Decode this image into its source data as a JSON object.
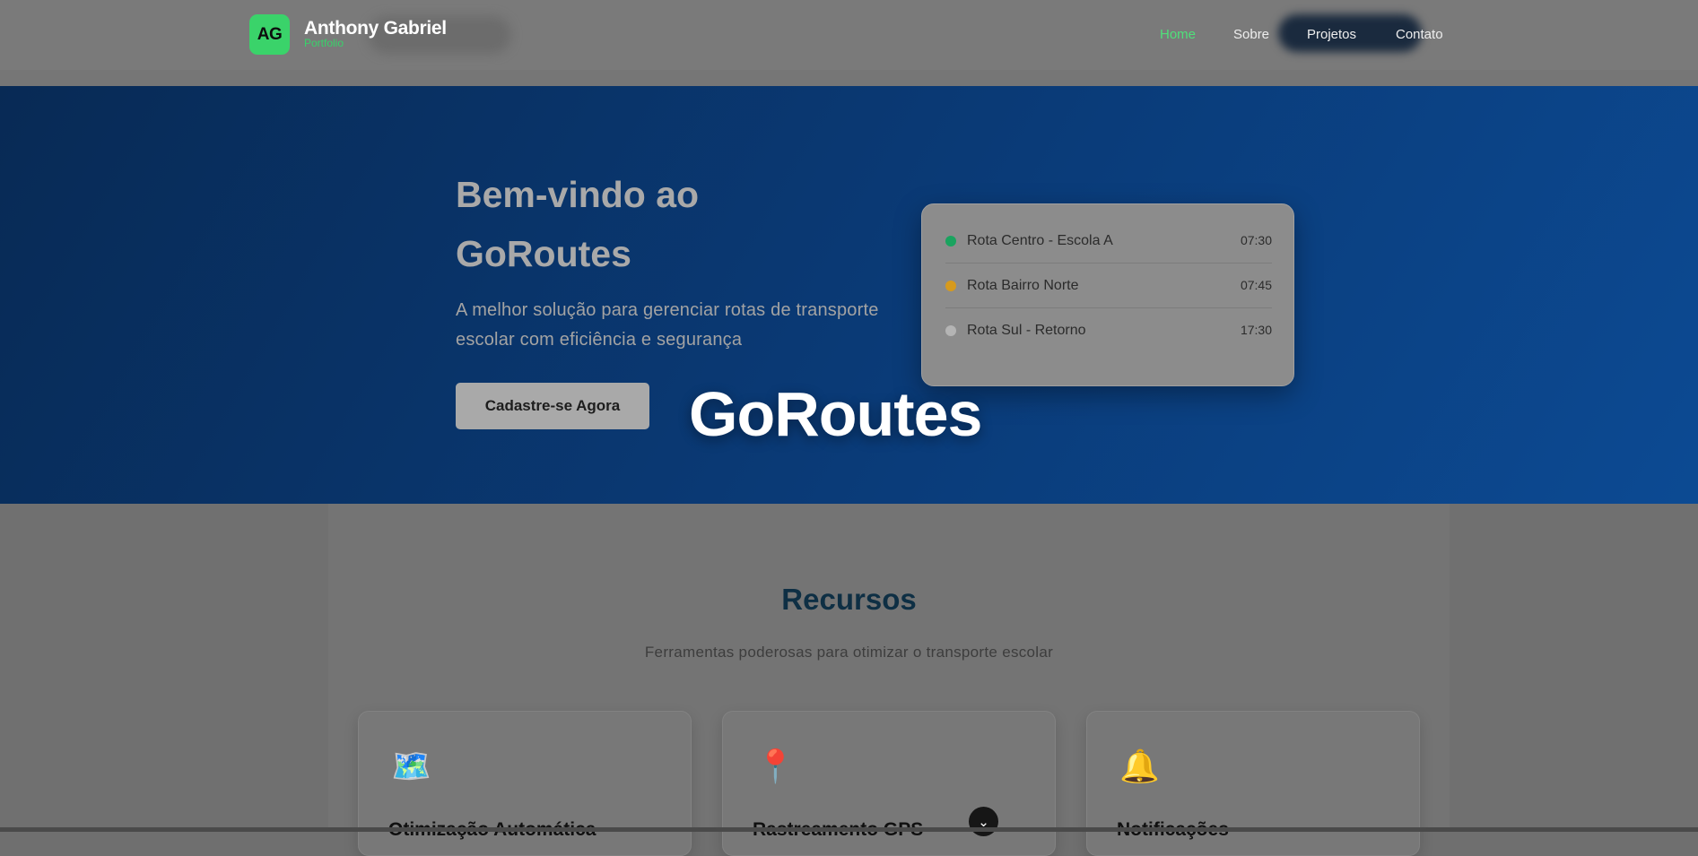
{
  "header": {
    "logo_initials": "AG",
    "brand_name": "Anthony Gabriel",
    "brand_sub": "Portfolio",
    "nav": [
      {
        "label": "Home",
        "active": true
      },
      {
        "label": "Sobre",
        "active": false
      },
      {
        "label": "Projetos",
        "active": false
      },
      {
        "label": "Contato",
        "active": false
      }
    ]
  },
  "hero": {
    "title_line1": "Bem-vindo ao",
    "title_line2": "GoRoutes",
    "subtitle": "A melhor solução para gerenciar rotas de transporte escolar com eficiência e segurança",
    "cta_label": "Cadastre-se Agora",
    "routes": [
      {
        "name": "Rota Centro - Escola A",
        "time": "07:30",
        "status_color": "#1aa35f"
      },
      {
        "name": "Rota Bairro Norte",
        "time": "07:45",
        "status_color": "#d69a1d"
      },
      {
        "name": "Rota Sul - Retorno",
        "time": "17:30",
        "status_color": "#b4b4b4"
      }
    ]
  },
  "overlay_title": "GoRoutes",
  "features": {
    "title": "Recursos",
    "subtitle": "Ferramentas poderosas para otimizar o transporte escolar",
    "cards": [
      {
        "icon": "map-icon",
        "glyph": "🗺️",
        "title": "Otimização Automática"
      },
      {
        "icon": "pin-icon",
        "glyph": "📍",
        "title": "Rastreamento GPS"
      },
      {
        "icon": "bell-icon",
        "glyph": "🔔",
        "title": "Notificações"
      }
    ]
  },
  "scroll_button": {
    "icon": "chevron-down-icon",
    "glyph": "⌄"
  },
  "colors": {
    "accent_green": "#38d26a",
    "hero_blue": "#0a3b78",
    "section_title": "#0e2f44"
  }
}
